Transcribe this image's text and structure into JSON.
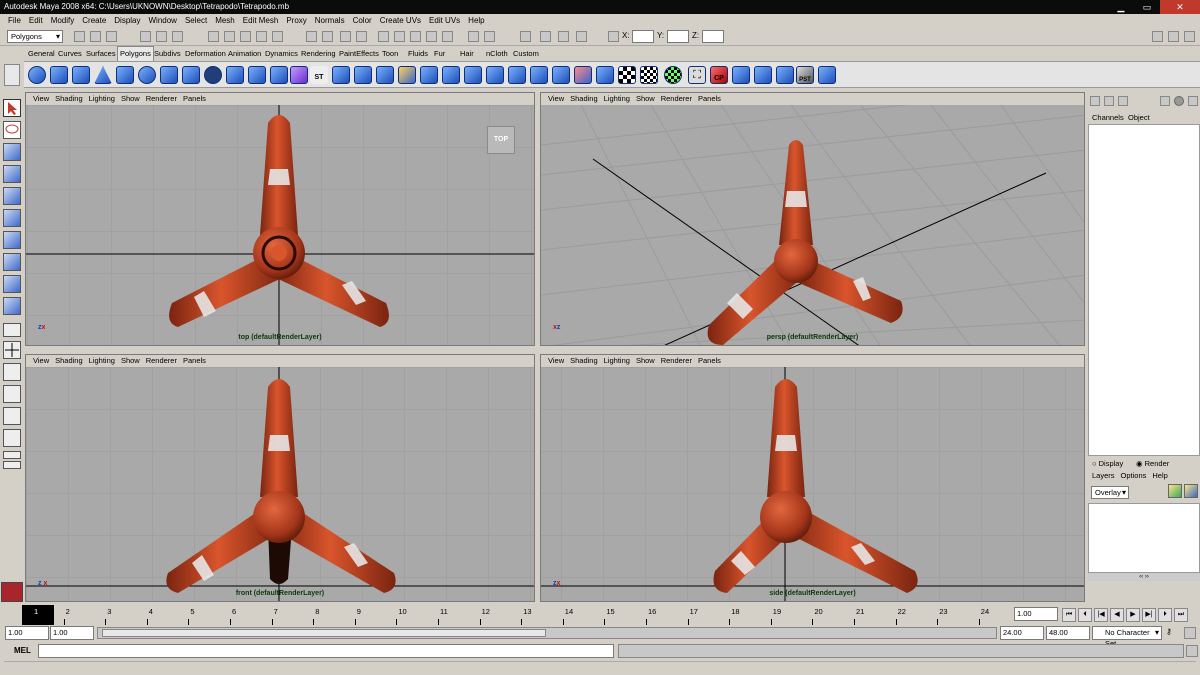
{
  "app": {
    "title": "Autodesk Maya 2008 x64: C:\\Users\\UKNOWN\\Desktop\\Tetrapodo\\Tetrapodo.mb"
  },
  "menubar": [
    "File",
    "Edit",
    "Modify",
    "Create",
    "Display",
    "Window",
    "Select",
    "Mesh",
    "Edit Mesh",
    "Proxy",
    "Normals",
    "Color",
    "Create UVs",
    "Edit UVs",
    "Help"
  ],
  "statusline": {
    "mode": "Polygons",
    "x_label": "X:",
    "y_label": "Y:",
    "z_label": "Z:"
  },
  "shelf_tabs": [
    "General",
    "Curves",
    "Surfaces",
    "Polygons",
    "Subdivs",
    "Deformation",
    "Animation",
    "Dynamics",
    "Rendering",
    "PaintEffects",
    "Toon",
    "Fluids",
    "Fur",
    "Hair",
    "nCloth",
    "Custom"
  ],
  "shelf_active": "Polygons",
  "shelf_icon_texts": [
    "ST",
    "CP",
    "PST"
  ],
  "viewport_menu": [
    "View",
    "Shading",
    "Lighting",
    "Show",
    "Renderer",
    "Panels"
  ],
  "viewports": [
    {
      "name": "top",
      "label": "top (defaultRenderLayer)",
      "view_cube": "TOP"
    },
    {
      "name": "persp",
      "label": "persp (defaultRenderLayer)"
    },
    {
      "name": "front",
      "label": "front (defaultRenderLayer)"
    },
    {
      "name": "side",
      "label": "side (defaultRenderLayer)"
    }
  ],
  "channel_box": {
    "tabs": [
      "Channels",
      "Object"
    ],
    "layer_modes": [
      "Display",
      "Render"
    ],
    "layer_mode_selected": "Render",
    "layer_menu": [
      "Layers",
      "Options",
      "Help"
    ],
    "layer_blend": "Overlay"
  },
  "timeline": {
    "ticks": [
      "1",
      "2",
      "3",
      "4",
      "5",
      "6",
      "7",
      "8",
      "9",
      "10",
      "11",
      "12",
      "13",
      "14",
      "15",
      "16",
      "17",
      "18",
      "19",
      "20",
      "21",
      "22",
      "23",
      "24"
    ],
    "current_frame": "1.00",
    "range_start": "1.00",
    "range_start_inner": "1.00",
    "range_end_inner": "24.00",
    "range_end": "48.00",
    "character_set": "No Character Set"
  },
  "command_line": {
    "label": "MEL"
  },
  "colors": {
    "viewport_bg": "#a9a9a9",
    "grid": "#999999",
    "tetrapod_orange": "#c2431f",
    "band_white": "#e6e6e6"
  }
}
